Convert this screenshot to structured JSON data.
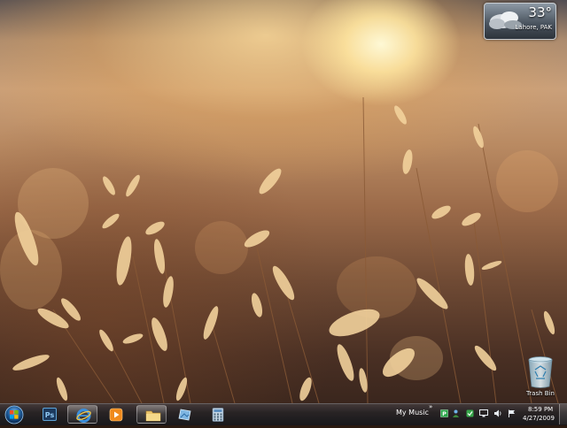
{
  "desktop": {
    "wallpaper": "golden-grass-sunset"
  },
  "weather_gadget": {
    "temperature": "33°",
    "location": "Lahore, PAK",
    "icon": "cloudy-icon"
  },
  "desktop_icons": [
    {
      "label": "Trash Bin",
      "icon": "recycle-bin-icon"
    }
  ],
  "taskbar": {
    "start_icon": "windows-start-orb-icon",
    "pinned": [
      {
        "name": "Photoshop",
        "icon": "photoshop-icon",
        "text": "Ps",
        "active": false
      },
      {
        "name": "Internet Explorer",
        "icon": "internet-explorer-icon",
        "active": true
      },
      {
        "name": "Windows Media Player",
        "icon": "media-player-icon",
        "active": false
      },
      {
        "name": "Windows Explorer",
        "icon": "folder-icon",
        "active": true
      },
      {
        "name": "Windows Photo Viewer",
        "icon": "photo-viewer-icon",
        "active": false
      },
      {
        "name": "Calculator",
        "icon": "calculator-icon",
        "active": false
      }
    ],
    "toolbar_label": "My Music",
    "toolbar_chevron": "»",
    "tray_icons": [
      "network-tray-icon",
      "people-tray-icon",
      "update-tray-icon",
      "display-tray-icon",
      "volume-icon",
      "action-center-flag-icon"
    ],
    "clock": {
      "time": "8:59 PM",
      "date": "4/27/2009"
    }
  },
  "colors": {
    "taskbar": "#28242a",
    "sun": "#fff8d8",
    "grass": "#f2d29c"
  }
}
